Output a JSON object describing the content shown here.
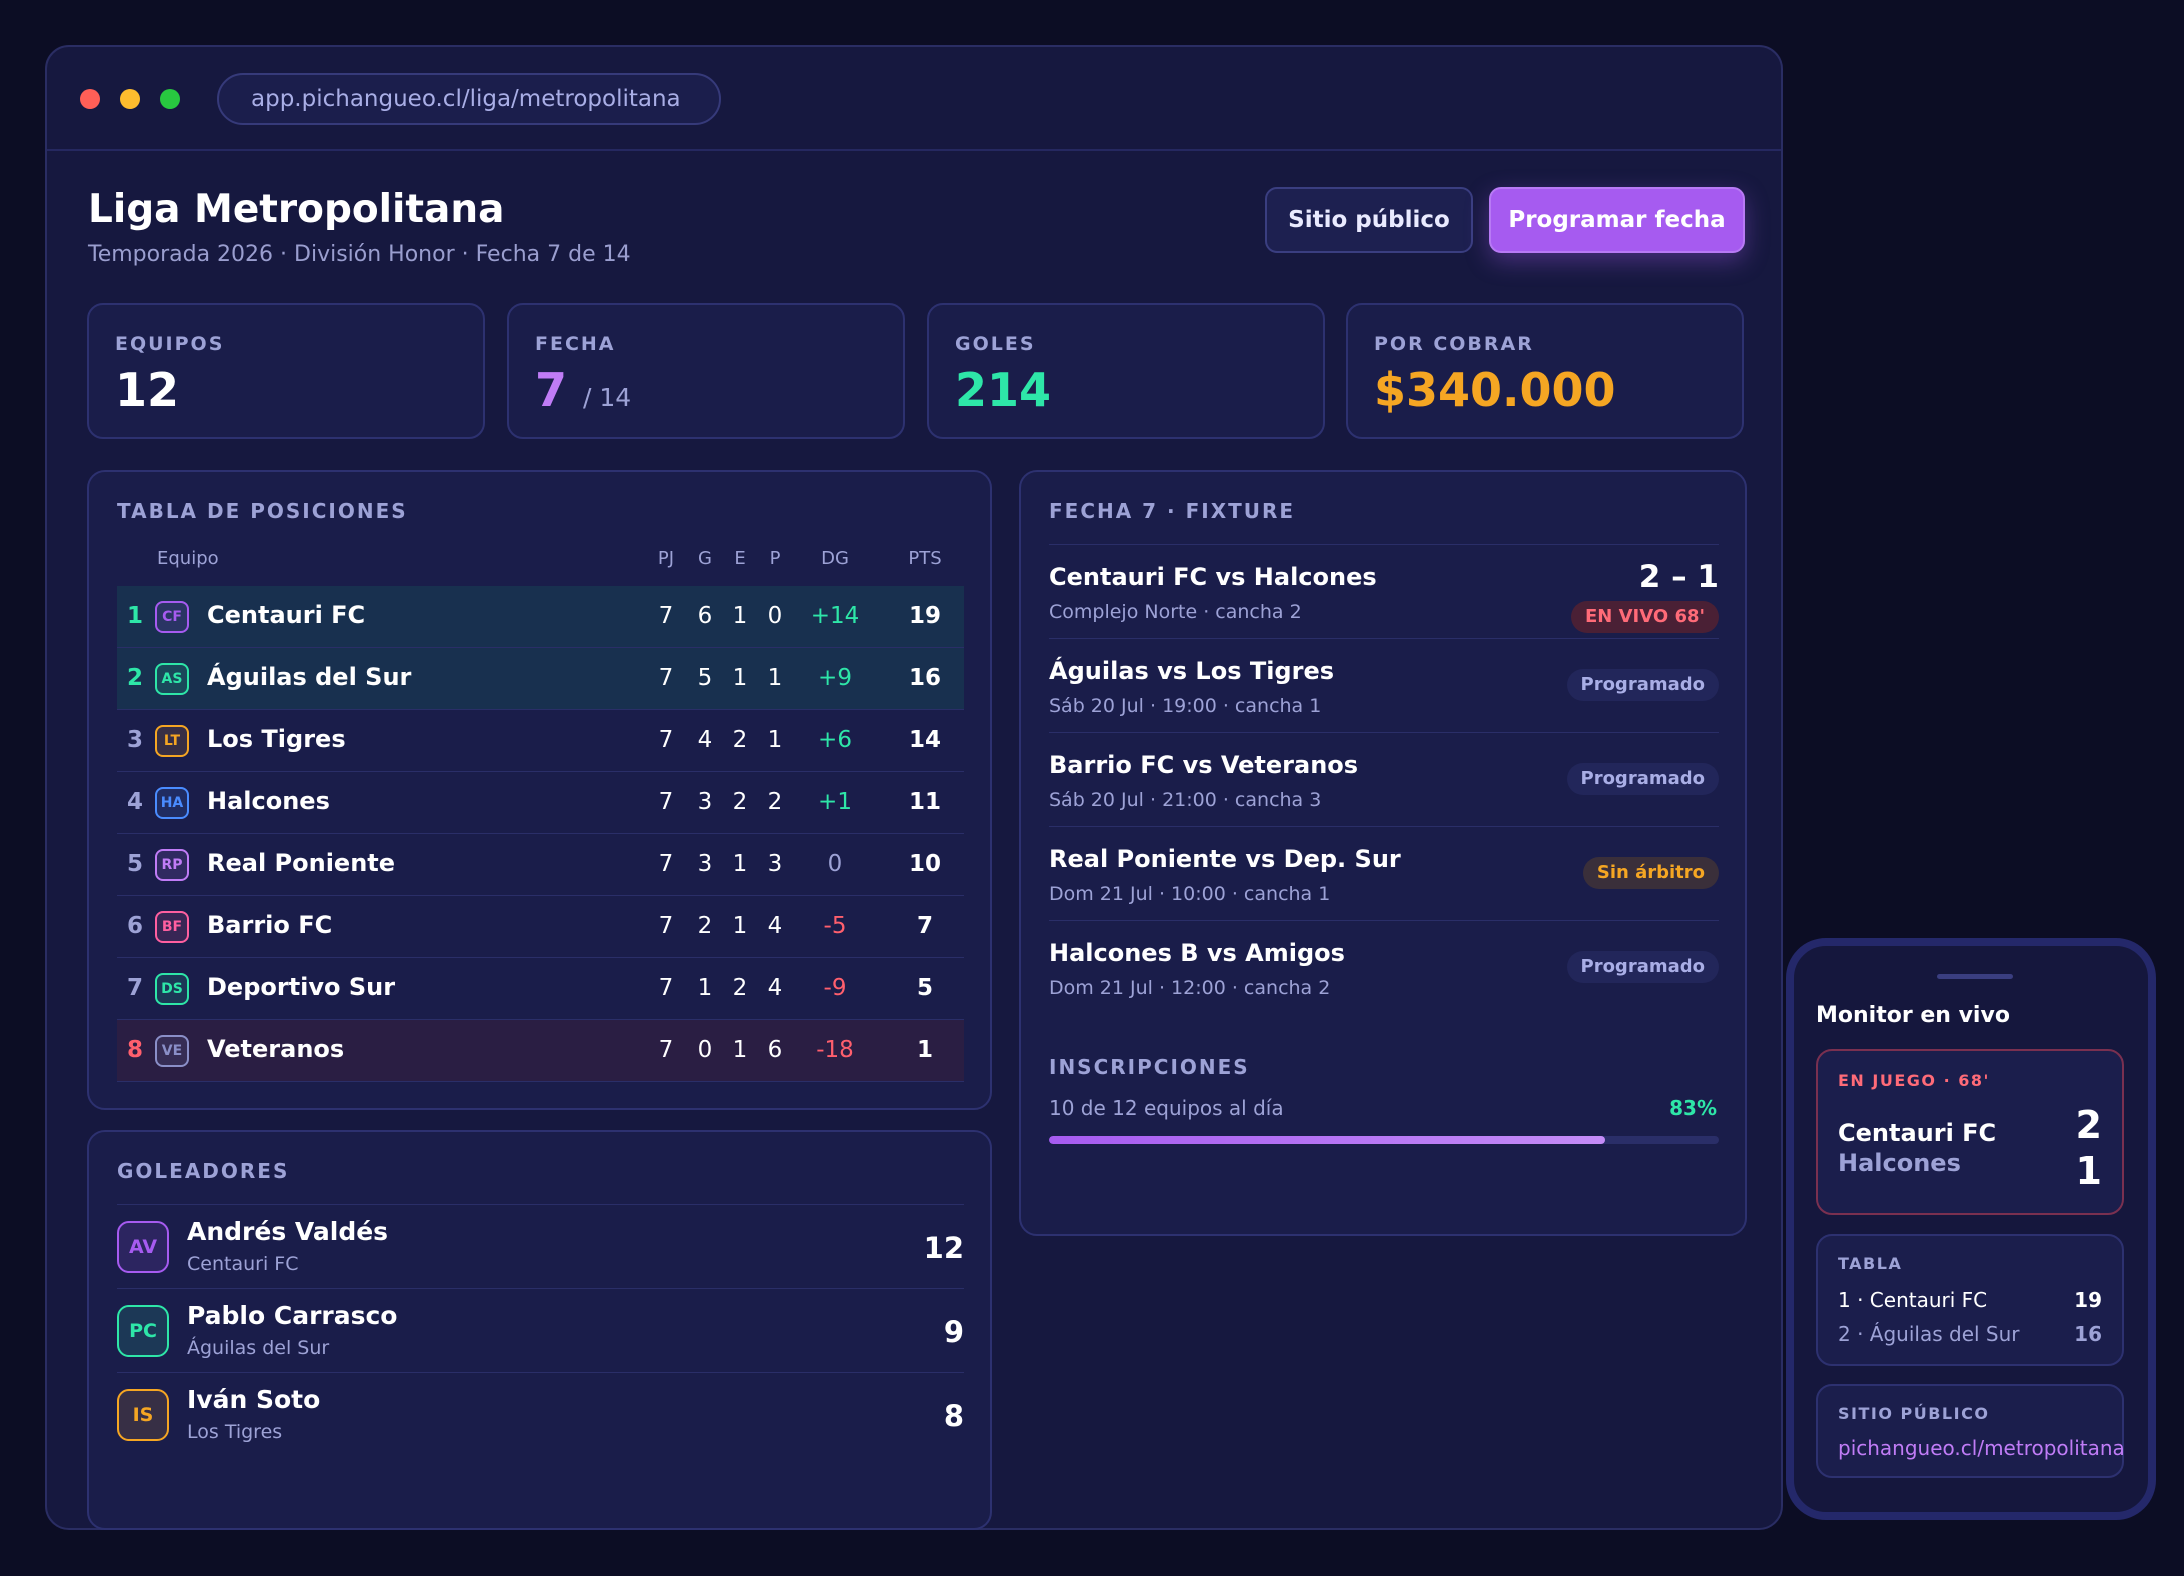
{
  "browser": {
    "url": "app.pichangueo.cl/liga/metropolitana"
  },
  "header": {
    "title": "Liga Metropolitana",
    "subtitle": "Temporada 2026 · División Honor · Fecha 7 de 14",
    "public_site_label": "Sitio público",
    "schedule_label": "Programar fecha"
  },
  "stats": [
    {
      "label": "EQUIPOS",
      "value": "12",
      "sub": "",
      "color": "#ffffff"
    },
    {
      "label": "FECHA",
      "value": "7",
      "sub": "/ 14",
      "color": "#c07cf6"
    },
    {
      "label": "GOLES",
      "value": "214",
      "sub": "",
      "color": "#2ee6a8"
    },
    {
      "label": "POR COBRAR",
      "value": "$340.000",
      "sub": "",
      "color": "#f5a623"
    }
  ],
  "standings": {
    "title": "TABLA DE POSICIONES",
    "headers": {
      "team": "Equipo",
      "pj": "PJ",
      "g": "G",
      "e": "E",
      "p": "P",
      "dg": "DG",
      "pts": "PTS"
    },
    "rows": [
      {
        "pos": "1",
        "abbr": "CF",
        "team": "Centauri FC",
        "pj": "7",
        "g": "6",
        "e": "1",
        "p": "0",
        "dg": "+14",
        "pts": "19",
        "zone": "lead",
        "badge_color": "#a65bf0"
      },
      {
        "pos": "2",
        "abbr": "AS",
        "team": "Águilas del Sur",
        "pj": "7",
        "g": "5",
        "e": "1",
        "p": "1",
        "dg": "+9",
        "pts": "16",
        "zone": "lead",
        "badge_color": "#2ee6a8"
      },
      {
        "pos": "3",
        "abbr": "LT",
        "team": "Los Tigres",
        "pj": "7",
        "g": "4",
        "e": "2",
        "p": "1",
        "dg": "+6",
        "pts": "14",
        "zone": "",
        "badge_color": "#f5a623"
      },
      {
        "pos": "4",
        "abbr": "HA",
        "team": "Halcones",
        "pj": "7",
        "g": "3",
        "e": "2",
        "p": "2",
        "dg": "+1",
        "pts": "11",
        "zone": "",
        "badge_color": "#4a8cff"
      },
      {
        "pos": "5",
        "abbr": "RP",
        "team": "Real Poniente",
        "pj": "7",
        "g": "3",
        "e": "1",
        "p": "3",
        "dg": "0",
        "pts": "10",
        "zone": "",
        "badge_color": "#c07cf6"
      },
      {
        "pos": "6",
        "abbr": "BF",
        "team": "Barrio FC",
        "pj": "7",
        "g": "2",
        "e": "1",
        "p": "4",
        "dg": "-5",
        "pts": "7",
        "zone": "",
        "badge_color": "#ff5fa0"
      },
      {
        "pos": "7",
        "abbr": "DS",
        "team": "Deportivo Sur",
        "pj": "7",
        "g": "1",
        "e": "2",
        "p": "4",
        "dg": "-9",
        "pts": "5",
        "zone": "",
        "badge_color": "#2ee6a8"
      },
      {
        "pos": "8",
        "abbr": "VE",
        "team": "Veteranos",
        "pj": "7",
        "g": "0",
        "e": "1",
        "p": "6",
        "dg": "-18",
        "pts": "1",
        "zone": "rel",
        "badge_color": "#8a8fc8"
      }
    ]
  },
  "scorers": {
    "title": "GOLEADORES",
    "rows": [
      {
        "initials": "AV",
        "name": "Andrés Valdés",
        "team": "Centauri FC",
        "goals": "12",
        "color": "#a65bf0"
      },
      {
        "initials": "PC",
        "name": "Pablo Carrasco",
        "team": "Águilas del Sur",
        "goals": "9",
        "color": "#2ee6a8"
      },
      {
        "initials": "IS",
        "name": "Iván Soto",
        "team": "Los Tigres",
        "goals": "8",
        "color": "#f5a623"
      }
    ]
  },
  "fixture": {
    "title": "FECHA 7 · FIXTURE",
    "matches": [
      {
        "match": "Centauri FC vs Halcones",
        "meta": "Complejo Norte · cancha 2",
        "score": "2 – 1",
        "status": "EN VIVO 68'",
        "kind": "live"
      },
      {
        "match": "Águilas vs Los Tigres",
        "meta": "Sáb 20 Jul · 19:00 · cancha 1",
        "score": "",
        "status": "Programado",
        "kind": "sched"
      },
      {
        "match": "Barrio FC vs Veteranos",
        "meta": "Sáb 20 Jul · 21:00 · cancha 3",
        "score": "",
        "status": "Programado",
        "kind": "sched"
      },
      {
        "match": "Real Poniente vs Dep. Sur",
        "meta": "Dom 21 Jul · 10:00 · cancha 1",
        "score": "",
        "status": "Sin árbitro",
        "kind": "warn"
      },
      {
        "match": "Halcones B vs Amigos",
        "meta": "Dom 21 Jul · 12:00 · cancha 2",
        "score": "",
        "status": "Programado",
        "kind": "sched"
      }
    ],
    "registrations": {
      "title": "INSCRIPCIONES",
      "text": "10 de 12 equipos al día",
      "percent_label": "83%",
      "progress": 0.83
    }
  },
  "phone": {
    "title": "Monitor en vivo",
    "live": {
      "label": "EN JUEGO · 68'",
      "team1": "Centauri FC",
      "team2": "Halcones",
      "score1": "2",
      "score2": "1"
    },
    "table": {
      "label": "TABLA",
      "rows": [
        {
          "text": "1 · Centauri FC",
          "pts": "19"
        },
        {
          "text": "2 · Águilas del Sur",
          "pts": "16"
        }
      ]
    },
    "site": {
      "label": "SITIO PÚBLICO",
      "link": "pichangueo.cl/metropolitana"
    }
  },
  "colors": {
    "positive": "#2ee6a8",
    "negative": "#ff5f6d",
    "neutral": "#9da2d6",
    "accent": "#a65bf0"
  }
}
